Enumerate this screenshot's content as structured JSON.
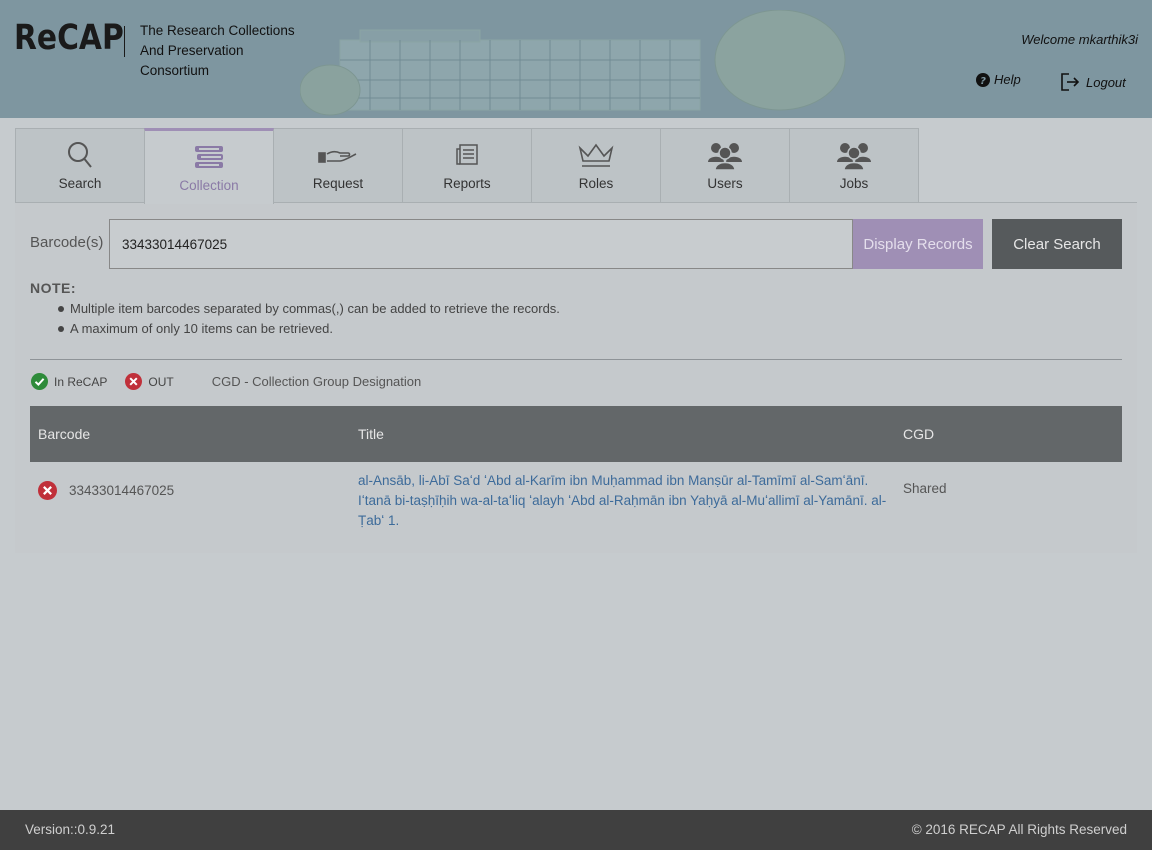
{
  "header": {
    "logo": "ReCAP",
    "subtitle": "The Research Collections And Preservation Consortium",
    "welcome": "Welcome mkarthik3i",
    "help_label": "Help",
    "logout_label": "Logout"
  },
  "tabs": [
    {
      "label": "Search",
      "icon": "search-icon"
    },
    {
      "label": "Collection",
      "icon": "books-icon",
      "active": true
    },
    {
      "label": "Request",
      "icon": "hand-icon"
    },
    {
      "label": "Reports",
      "icon": "document-icon"
    },
    {
      "label": "Roles",
      "icon": "crown-icon"
    },
    {
      "label": "Users",
      "icon": "users-icon"
    },
    {
      "label": "Jobs",
      "icon": "users-icon"
    }
  ],
  "search": {
    "label": "Barcode(s)",
    "value": "33433014467025",
    "display_button": "Display Records",
    "clear_button": "Clear Search"
  },
  "note": {
    "title": "NOTE:",
    "items": [
      "Multiple item barcodes separated by commas(,) can be added to retrieve the records.",
      "A maximum of only 10 items can be retrieved."
    ]
  },
  "legend": {
    "in_label": "In ReCAP",
    "out_label": "OUT",
    "cgd_note": "CGD - Collection Group Designation"
  },
  "table": {
    "headers": {
      "barcode": "Barcode",
      "title": "Title",
      "cgd": "CGD"
    },
    "rows": [
      {
        "status": "out",
        "barcode": "33433014467025",
        "title": "al-Ansāb, li-Abī Saʻd ʻAbd al-Karīm ibn Muḥammad ibn Manṣūr al-Tamīmī al-Samʻānī. Iʻtanā bi-taṣḥīḥih wa-al-taʻliq ʻalayh ʻAbd al-Raḥmān ibn Yaḥyā al-Muʻallimī al-Yamānī. al-Ṭabʻ 1.",
        "cgd": "Shared"
      }
    ]
  },
  "footer": {
    "version": "Version::0.9.21",
    "copyright": "© 2016 RECAP All Rights Reserved"
  },
  "colors": {
    "header_bg": "#7e96a0",
    "accent": "#9f8fb5",
    "table_header": "#636769",
    "link": "#3d6b9a",
    "in_green": "#2e8b3a",
    "out_red": "#c0303a"
  }
}
